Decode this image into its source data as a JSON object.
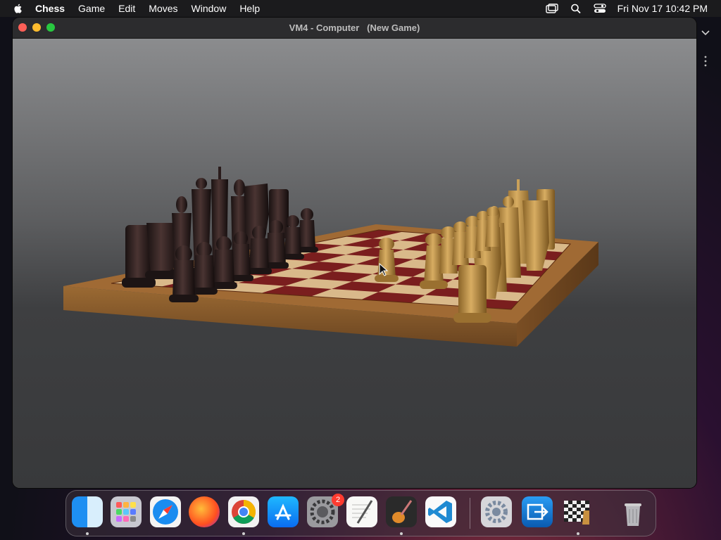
{
  "menubar": {
    "app_name": "Chess",
    "items": [
      "Game",
      "Edit",
      "Moves",
      "Window",
      "Help"
    ],
    "clock": "Fri Nov 17  10:42 PM"
  },
  "window": {
    "title": "VM4 - Computer   (New Game)"
  },
  "dock": {
    "apps": [
      "finder-icon",
      "launchpad-icon",
      "safari-icon",
      "firefox-icon",
      "chrome-icon",
      "app-store-icon",
      "system-settings-icon",
      "textedit-icon",
      "garageband-icon",
      "vscode-icon",
      "preferences-icon",
      "migration-assistant-icon",
      "chess-icon",
      "trash-icon"
    ],
    "settings_badge": "2"
  },
  "colors": {
    "close": "#fe5f57",
    "minimize": "#febc2e",
    "zoom": "#28c840",
    "dark_square": "#7a1e1e",
    "light_square": "#d9b98a",
    "board_wood": "#8a5a2b"
  }
}
